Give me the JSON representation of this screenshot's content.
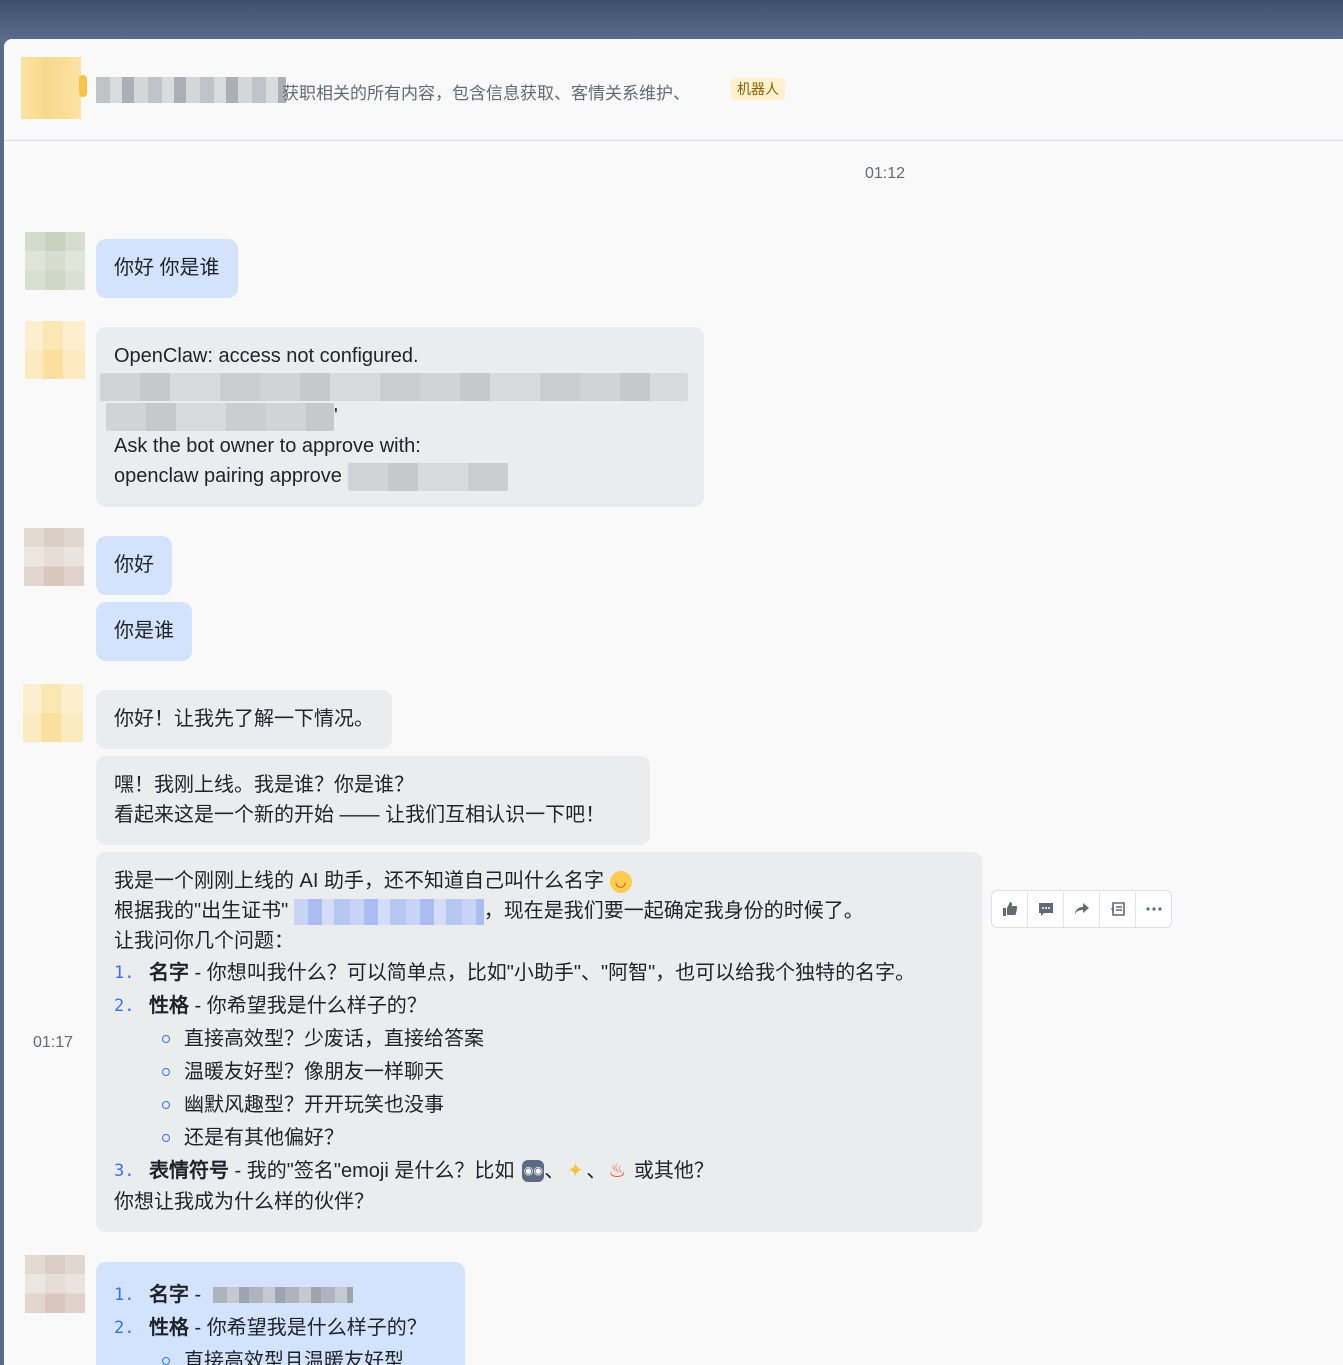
{
  "header": {
    "group_description": "获职相关的所有内容，包含信息获取、客情关系维护、",
    "bot_tag": "机器人"
  },
  "timestamps": {
    "first": "01:12",
    "second": "01:17"
  },
  "messages": {
    "m1": "你好 你是谁",
    "m2": {
      "line1": "OpenClaw: access not configured.",
      "line3_tail": "'",
      "line4": "Ask the bot owner to approve with:",
      "line5": "openclaw pairing approve"
    },
    "m3": "你好",
    "m4": "你是谁",
    "m5": "你好！让我先了解一下情况。",
    "m6": {
      "line1": "嘿！我刚上线。我是谁？你是谁？",
      "line2": "看起来这是一个新的开始 —— 让我们互相认识一下吧！"
    },
    "m7": {
      "intro1": "我是一个刚刚上线的 AI 助手，还不知道自己叫什么名字",
      "intro2_a": "根据我的\"出生证书\"",
      "intro2_b": "，现在是我们要一起确定我身份的时候了。",
      "intro3": "让我问你几个问题：",
      "items": [
        {
          "num": "1.",
          "title": "名字",
          "text": " - 你想叫我什么？可以简单点，比如\"小助手\"、\"阿智\"，也可以给我个独特的名字。"
        },
        {
          "num": "2.",
          "title": "性格",
          "text": " - 你希望我是什么样子的？"
        },
        {
          "num": "3.",
          "title": "表情符号",
          "text": " - 我的\"签名\"emoji 是什么？比如"
        }
      ],
      "subitems": [
        "直接高效型？少废话，直接给答案",
        "温暖友好型？像朋友一样聊天",
        "幽默风趣型？开开玩笑也没事",
        "还是有其他偏好？"
      ],
      "sep": "、",
      "item3_tail": " 或其他？",
      "outro": "你想让我成为什么样的伙伴？"
    },
    "m8": {
      "items": [
        {
          "num": "1.",
          "title": "名字",
          "text": " -"
        },
        {
          "num": "2.",
          "title": "性格",
          "text": " - 你希望我是什么样子的？"
        }
      ],
      "sub1": "直接高效型且温暖友好型"
    }
  },
  "toolbar": [
    "thumbs-up-icon",
    "comment-icon",
    "forward-icon",
    "quote-icon",
    "more-icon"
  ],
  "colors": {
    "user_bubble": "#d3e3fd",
    "bot_bubble": "#ebecee",
    "accent": "#3370ff",
    "bot_tag_bg": "#fdf1cf"
  }
}
